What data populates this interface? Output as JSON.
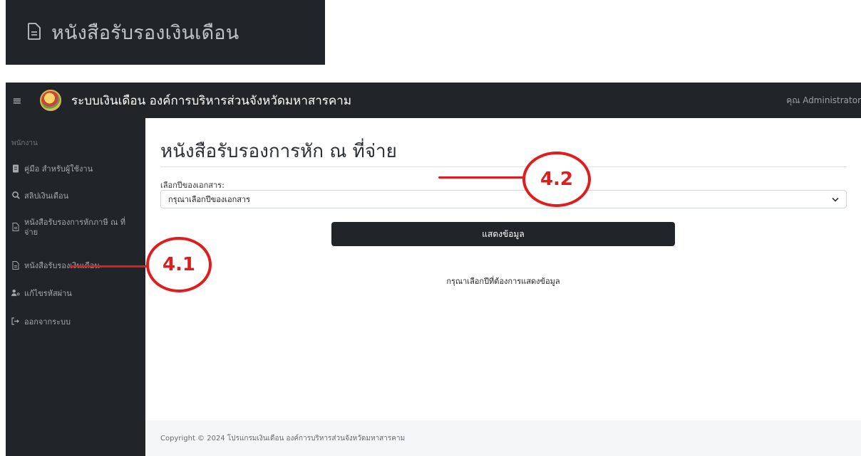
{
  "inset": {
    "title": "หนังสือรับรองเงินเดือน",
    "icon": "document-icon"
  },
  "navbar": {
    "menu_icon": "≡",
    "brand": "ระบบเงินเดือน องค์การบริหารส่วนจังหวัดมหาสารคาม",
    "user": "คุณ Administrator"
  },
  "sidebar": {
    "heading": "พนักงาน",
    "items": [
      {
        "label": "คู่มือ สำหรับผู้ใช้งาน",
        "icon": "manual-icon"
      },
      {
        "label": "สลิปเงินเดือน",
        "icon": "search-icon"
      },
      {
        "label": "หนังสือรับรองการหักภาษี ณ ที่จ่าย",
        "icon": "document-icon"
      },
      {
        "label": "หนังสือรับรองเงินเดือน",
        "icon": "document-icon"
      },
      {
        "label": "แก้ไขรหัสผ่าน",
        "icon": "user-key-icon"
      },
      {
        "label": "ออกจากระบบ",
        "icon": "logout-icon"
      }
    ]
  },
  "main": {
    "title": "หนังสือรับรองการหัก ณ ที่จ่าย",
    "select_label": "เลือกปีของเอกสาร:",
    "select_value": "กรุณาเลือกปีของเอกสาร",
    "button_label": "แสดงข้อมูล",
    "hint": "กรุณาเลือกปีที่ต้องการแสดงข้อมูล"
  },
  "footer": {
    "text": "Copyright © 2024 โปรแกรมเงินเดือน องค์การบริหารส่วนจังหวัดมหาสารคาม"
  },
  "annotations": {
    "a1": "4.1",
    "a2": "4.2"
  },
  "colors": {
    "dark": "#212529",
    "accent_red": "#e11c1c",
    "footer_bg": "#f5f6f7"
  }
}
